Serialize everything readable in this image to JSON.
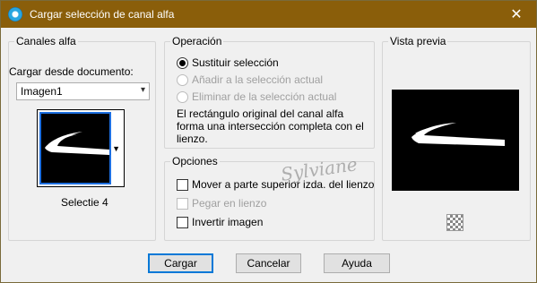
{
  "window": {
    "title": "Cargar selección de canal alfa",
    "close_glyph": "✕",
    "app_icon": "paintshop-icon"
  },
  "canales": {
    "title": "Canales alfa",
    "cargar_label": "Cargar desde documento:",
    "document_value": "Imagen1",
    "channel_name": "Selectie 4"
  },
  "operacion": {
    "title": "Operación",
    "options": [
      {
        "label": "Sustituir selección",
        "checked": true,
        "enabled": true
      },
      {
        "label": "Añadir a la selección actual",
        "checked": false,
        "enabled": false
      },
      {
        "label": "Eliminar de la selección actual",
        "checked": false,
        "enabled": false
      }
    ],
    "description": "El rectángulo original del canal alfa forma una intersección completa con el lienzo."
  },
  "opciones": {
    "title": "Opciones",
    "items": [
      {
        "label": "Mover a parte superior izda. del lienzo",
        "checked": false,
        "enabled": true
      },
      {
        "label": "Pegar en lienzo",
        "checked": false,
        "enabled": false
      },
      {
        "label": "Invertir imagen",
        "checked": false,
        "enabled": true
      }
    ]
  },
  "vista": {
    "title": "Vista previa"
  },
  "buttons": {
    "ok": "Cargar",
    "cancel": "Cancelar",
    "help": "Ayuda"
  },
  "watermark": "Sylviane",
  "colors": {
    "titlebar": "#8a5e0a",
    "accent": "#0078d7"
  }
}
